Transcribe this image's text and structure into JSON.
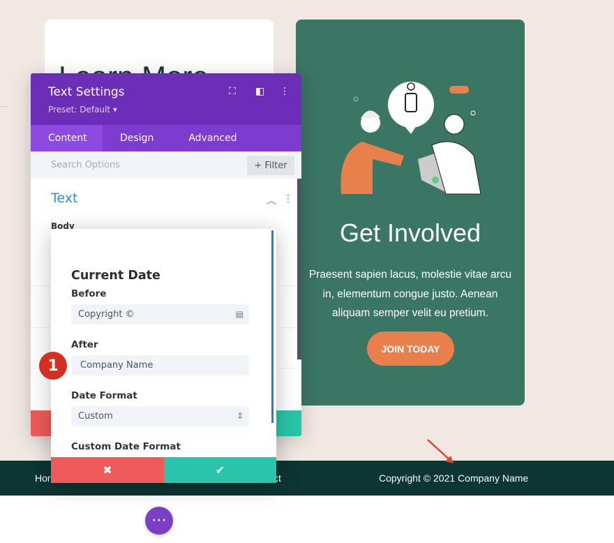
{
  "left_card": {
    "title": "Learn More"
  },
  "right_card": {
    "title": "Get Involved",
    "body": "Praesent sapien lacus, molestie vitae arcu in, elementum congue justo. Aenean aliquam semper velit eu pretium.",
    "button": "JOIN TODAY",
    "bg_color": "#3b7563",
    "button_color": "#e9804b"
  },
  "footer": {
    "left_fragment": "Hor",
    "mid_fragment": "ct",
    "copyright": "Copyright © 2021 Company Name"
  },
  "settings": {
    "title": "Text Settings",
    "preset": "Preset: Default ▾",
    "tabs": [
      "Content",
      "Design",
      "Advanced"
    ],
    "search_placeholder": "Search Options",
    "filter": "+ Filter",
    "section": "Text",
    "body_label": "Body",
    "accent": "#6c2eb9"
  },
  "popup": {
    "heading": "Current Date",
    "before_label": "Before",
    "before_value": "Copyright ©",
    "after_label": "After",
    "after_value": "Company Name",
    "date_format_label": "Date Format",
    "date_format_value": "Custom",
    "custom_format_label": "Custom Date Format"
  },
  "badge": "1",
  "fab": "⋯"
}
